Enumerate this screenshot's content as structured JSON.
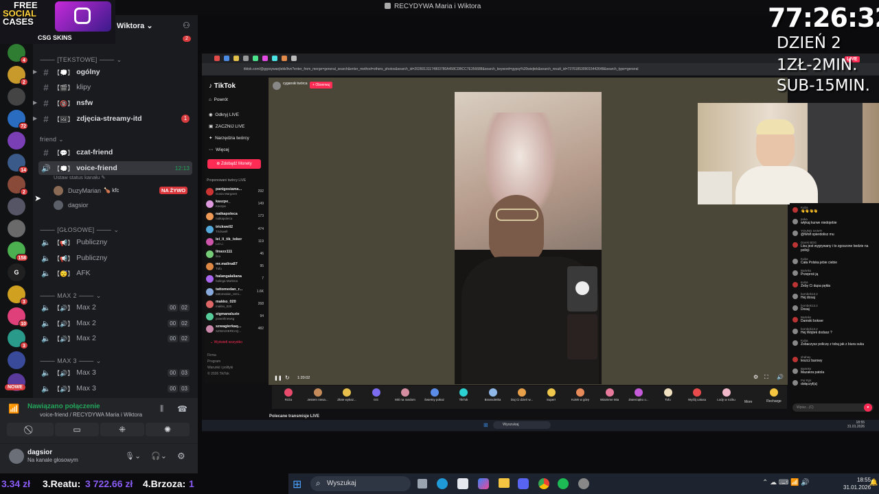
{
  "window": {
    "title": "RECYDYWA Maria i Wiktora"
  },
  "overlay": {
    "timer": "77:26:32",
    "day": "DZIEŃ 2",
    "price1": "1ZŁ-2MIN.",
    "price2": "SUB-15MIN.",
    "logo_line1": "FREE",
    "logo_line2": "SOCIAL",
    "logo_line3": "CASES",
    "logo_brand": "CSG SKINS"
  },
  "discord": {
    "server_name": "Wiktora",
    "rail_badges": [
      "4",
      "2",
      "72",
      "14",
      "2",
      "158",
      "3",
      "10",
      "3"
    ],
    "rail_new": "NOWE",
    "server_badge_top": "2",
    "categories": {
      "text": "[TEKSTOWE]",
      "friend": "friend",
      "voice": "[GŁOSOWE]",
      "max2": "MAX 2",
      "max3": "MAX 3"
    },
    "channels": [
      {
        "name": "ogólny"
      },
      {
        "name": "klipy"
      },
      {
        "name": "nsfw"
      },
      {
        "name": "zdjęcia-streamy-itd",
        "badge": "1"
      },
      {
        "name": "czat-friend"
      },
      {
        "name": "voice-friend",
        "time": "12:13",
        "status": "Ustaw status kanału"
      }
    ],
    "voice_users": [
      {
        "name": "DuzyMarian",
        "extra": "kfc",
        "live": "NA ŻYWO"
      },
      {
        "name": "dagsior"
      }
    ],
    "voice_channels": [
      "Publiczny",
      "Publiczny",
      "AFK"
    ],
    "max2_channels": [
      {
        "name": "Max 2",
        "a": "00",
        "b": "02"
      },
      {
        "name": "Max 2",
        "a": "00",
        "b": "02"
      },
      {
        "name": "Max 2",
        "a": "00",
        "b": "02"
      }
    ],
    "max3_channels": [
      {
        "name": "Max 3",
        "a": "00",
        "b": "03"
      },
      {
        "name": "Max 3",
        "a": "00",
        "b": "03"
      }
    ],
    "connection": {
      "status": "Nawiązano połączenie",
      "channel": "voice-friend / RECYDYWA Maria i Wiktora"
    },
    "user": {
      "name": "dagsior",
      "status": "Na kanale głosowym"
    }
  },
  "ticker": {
    "left_amount": "3.34 zł",
    "rank": "3.Reatu:",
    "rank_amount": "3 722.66 zł",
    "rank4": "4.Brzoza:",
    "rank4_amount": "1"
  },
  "taskbar": {
    "search": "Wyszukaj",
    "time": "18:55",
    "date": "31.01.2026"
  },
  "browser": {
    "url": "tiktok.com/@gypsywaejtekk/live?enter_from_merge=general_search&enter_method=others_photos&search_id=20260131174803780A458CDBCC7E356688&search_keyword=gypsy%20wiejtek&search_result_id=7376185309015442648&search_type=general"
  },
  "tiktok": {
    "logo": "TikTok",
    "nav": [
      "Powrót",
      "Odkryj LIVE",
      "ZACZNIJ LIVE",
      "Narzędzia twórcy",
      "Więcej"
    ],
    "coins_button": "Zdobądź Monety",
    "suggested_title": "Proponowani twórcy LIVE",
    "creators": [
      {
        "name": "panigosiama...",
        "sub": "Gosia Margaret",
        "count": "292"
      },
      {
        "name": "kaszpe_",
        "sub": "Kaszpe",
        "count": "149"
      },
      {
        "name": "natkapoleca",
        "sub": "natkapoleca",
        "count": "173"
      },
      {
        "name": "trickwell2",
        "sub": "Trickwell",
        "count": "474"
      },
      {
        "name": "lei_li_tik_toker",
        "sub": "Lei Li",
        "count": "119"
      },
      {
        "name": "linaxx111",
        "sub": "lina",
        "count": "46"
      },
      {
        "name": "mr.malina87",
        "sub": "Tufu",
        "count": "95"
      },
      {
        "name": "halangalaliana",
        "sub": "halinga Marlena",
        "count": "7"
      },
      {
        "name": "tattomedan_r...",
        "sub": "tattomedan_remi...",
        "count": "1.6K"
      },
      {
        "name": "makko_020",
        "sub": "makko_020",
        "count": "268"
      },
      {
        "name": "sigmanaluzie",
        "sub": "powerlinewsg",
        "count": "94"
      },
      {
        "name": "szwagierkaq...",
        "sub": "SZWAGIERKAQ...",
        "count": "482"
      }
    ],
    "show_all": "Wyświetl wszystko",
    "footer": [
      "Firma",
      "Program",
      "Warunki i polityki",
      "© 2026 TikTok"
    ],
    "host": "cyganski twórca",
    "follow": "Obserwuj",
    "elapsed": "1:20:02",
    "recommended": "Polecane transmisje LIVE",
    "gifts": [
      {
        "name": "Róża",
        "color": "#e84b6b"
      },
      {
        "name": "Jestem niesa...",
        "color": "#c58b5b"
      },
      {
        "name": "Złote wykaz...",
        "color": "#e8c04b"
      },
      {
        "name": "GG",
        "color": "#7b6cf0"
      },
      {
        "name": "Miś na random",
        "color": "#d58ea0"
      },
      {
        "name": "Świetny pokaz",
        "color": "#5b8de8"
      },
      {
        "name": "TikTok",
        "color": "#2cd2d2"
      },
      {
        "name": "Bransoletka",
        "color": "#8fb8e8"
      },
      {
        "name": "Daj Ci dzień w...",
        "color": "#e8a04b"
      },
      {
        "name": "Super!",
        "color": "#f0c84b"
      },
      {
        "name": "Kolek w górę",
        "color": "#e88b5b"
      },
      {
        "name": "Wiaimme Mia",
        "color": "#e87b9b"
      },
      {
        "name": "Zwierzątko o...",
        "color": "#c55bd8"
      },
      {
        "name": "Tofu",
        "color": "#f0e0c0"
      },
      {
        "name": "Wyślij całusa",
        "color": "#e84b4b"
      },
      {
        "name": "Lody w rożku",
        "color": "#f0b8c8"
      }
    ],
    "more": "More",
    "recharge": "Recharge",
    "chat": [
      {
        "user": "Kuba",
        "msg": "👋👋👋👋"
      },
      {
        "user": "poka",
        "msg": "włykaj kurwe niedojebie"
      },
      {
        "user": "YOUNG SANTI",
        "msg": "@Wolf opierdolisz mu"
      },
      {
        "user": "Darek BDG",
        "msg": "Lisu jest wygrywany i to zgoszone bedzie na policji"
      },
      {
        "user": "Kuba",
        "msg": "Cała Polska jebie ciebie"
      },
      {
        "user": "Barteks",
        "msg": "Przeproś ją"
      },
      {
        "user": "Kuba",
        "msg": "Żeby Ci dupa pękła"
      },
      {
        "user": "bombek13.2",
        "msg": "Hej dosaj"
      },
      {
        "user": "bombek13.2",
        "msg": "Dosaj"
      },
      {
        "user": "Barteks",
        "msg": "Damski bokser"
      },
      {
        "user": "bombek13.2",
        "msg": "Hej Wojtek dodasz ?"
      },
      {
        "user": "Kuba",
        "msg": "Zobaczysz policzę z tobą jak z biura suka"
      },
      {
        "user": "shahay",
        "msg": "leszcz barowy"
      },
      {
        "user": "Barteks",
        "msg": "Mazakra patola"
      },
      {
        "user": "Pal Ryk",
        "msg": "dołączył(a)"
      }
    ],
    "chat_placeholder": "Wpisz...(C)"
  },
  "inner_taskbar": {
    "search": "Wyszukaj",
    "time": "18:55",
    "date": "31.01.2026"
  }
}
